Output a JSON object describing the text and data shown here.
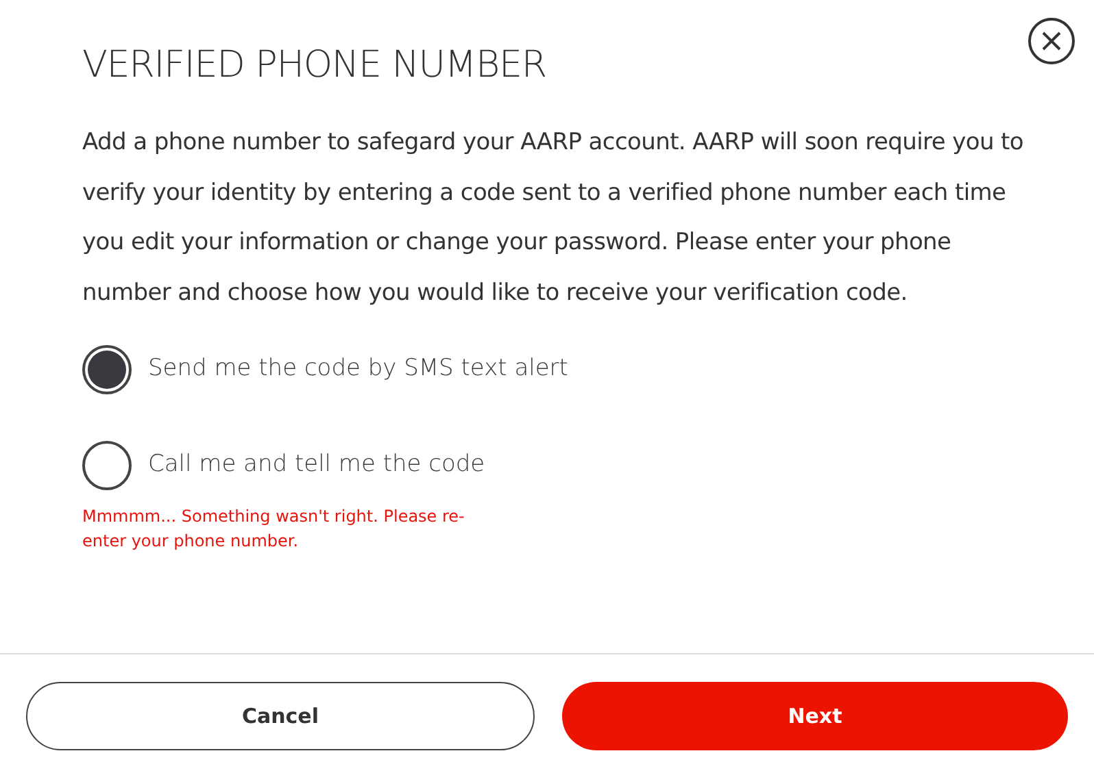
{
  "dialog": {
    "title": "VERIFIED PHONE NUMBER",
    "description": "Add a phone number to safegard your AARP account. AARP will soon require you to verify your identity by entering a code sent to a verified phone number each time you edit your information or change your password. Please enter your phone number and choose how you would like to receive your verification code.",
    "options": [
      {
        "label": "Send me the code by SMS text alert",
        "selected": true
      },
      {
        "label": "Call me and tell me the code",
        "selected": false
      }
    ],
    "error": "Mmmmm... Something wasn't right. Please re-enter your phone number.",
    "buttons": [
      {
        "label": "Cancel",
        "kind": "secondary"
      },
      {
        "label": "Next",
        "kind": "primary"
      }
    ]
  }
}
